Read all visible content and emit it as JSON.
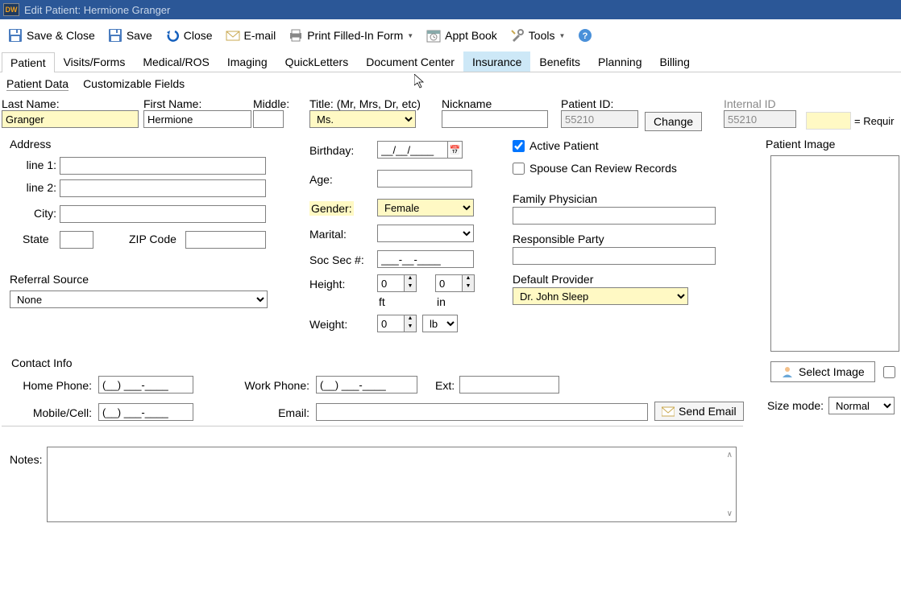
{
  "window": {
    "title": "Edit Patient: Hermione Granger",
    "logo_text": "DW"
  },
  "toolbar": {
    "save_close": "Save & Close",
    "save": "Save",
    "close": "Close",
    "email": "E-mail",
    "print": "Print Filled-In Form",
    "appt": "Appt Book",
    "tools": "Tools"
  },
  "tabs": [
    "Patient",
    "Visits/Forms",
    "Medical/ROS",
    "Imaging",
    "QuickLetters",
    "Document Center",
    "Insurance",
    "Benefits",
    "Planning",
    "Billing"
  ],
  "subtabs": [
    "Patient Data",
    "Customizable Fields"
  ],
  "labels": {
    "last_name": "Last Name:",
    "first_name": "First Name:",
    "middle": "Middle:",
    "title": "Title: (Mr, Mrs, Dr, etc)",
    "nickname": "Nickname",
    "patient_id": "Patient ID:",
    "internal_id": "Internal ID",
    "required": "= Requir",
    "address": "Address",
    "line1": "line 1:",
    "line2": "line 2:",
    "city": "City:",
    "state": "State",
    "zip": "ZIP Code",
    "referral": "Referral Source",
    "birthday": "Birthday:",
    "age": "Age:",
    "gender": "Gender:",
    "marital": "Marital:",
    "ssn": "Soc Sec #:",
    "height": "Height:",
    "ft": "ft",
    "in": "in",
    "weight": "Weight:",
    "lb_unit": "lb",
    "active": "Active Patient",
    "spouse": "Spouse Can Review Records",
    "family_phys": "Family Physician",
    "resp_party": "Responsible Party",
    "default_prov": "Default Provider",
    "patient_image": "Patient Image",
    "select_image": "Select Image",
    "size_mode": "Size mode:",
    "contact_info": "Contact Info",
    "home_phone": "Home Phone:",
    "work_phone": "Work Phone:",
    "ext": "Ext:",
    "mobile": "Mobile/Cell:",
    "email_lbl": "Email:",
    "send_email": "Send Email",
    "notes": "Notes:"
  },
  "values": {
    "last_name": "Granger",
    "first_name": "Hermione",
    "middle": "",
    "title": "Ms.",
    "nickname": "",
    "patient_id": "55210",
    "internal_id": "55210",
    "change_btn": "Change",
    "line1": "",
    "line2": "",
    "city": "",
    "state": "",
    "zip": "",
    "referral": "None",
    "birthday": "__/__/____",
    "age": "",
    "gender": "Female",
    "marital": "",
    "ssn": "___-__-____",
    "height_ft": "0",
    "height_in": "0",
    "weight": "0",
    "active_patient": true,
    "spouse_review": false,
    "family_phys": "",
    "resp_party": "",
    "default_prov": "Dr. John Sleep",
    "size_mode": "Normal",
    "home_phone": "(__) ___-____",
    "work_phone": "(__) ___-____",
    "ext": "",
    "mobile": "(__) ___-____",
    "email": "",
    "notes": ""
  }
}
